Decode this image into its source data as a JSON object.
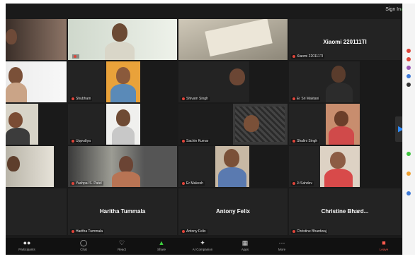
{
  "topbar": {
    "sign_in": "Sign In"
  },
  "tiles": [
    {
      "id": "t1",
      "name": ""
    },
    {
      "id": "t2",
      "name": ""
    },
    {
      "id": "t3",
      "name": ""
    },
    {
      "id": "t4",
      "big_name": "Xiaomi 220111TI",
      "name": "Xiaomi 220111TI"
    },
    {
      "id": "t5",
      "name": ""
    },
    {
      "id": "t6",
      "name": "Shubham"
    },
    {
      "id": "t7",
      "name": "Shivam Singh"
    },
    {
      "id": "t8",
      "name": "Er Sri Maktani"
    },
    {
      "id": "t9",
      "name": ""
    },
    {
      "id": "t10",
      "name": "Uppvdiya"
    },
    {
      "id": "t11",
      "name": "Sachin Kumar"
    },
    {
      "id": "t12",
      "name": "Shalini Singh"
    },
    {
      "id": "t13",
      "name": ""
    },
    {
      "id": "t14",
      "name": "Yashpal S. Patel"
    },
    {
      "id": "t15",
      "name": "Ritesh Kumar"
    },
    {
      "id": "t16",
      "name": "Er Makesh"
    },
    {
      "id": "t17",
      "name": "Ji Sahdev"
    },
    {
      "id": "t18",
      "big_name": "Haritha Tummala",
      "name": "Haritha Tummala"
    },
    {
      "id": "t19",
      "big_name": "Antony Felix",
      "name": "Antony Felix"
    },
    {
      "id": "t20",
      "big_name": "Christine Bhard...",
      "name": "Christine Bhardwaj"
    }
  ],
  "toolbar": {
    "participants": "Participants",
    "chat": "Chat",
    "react": "React",
    "share": "Share",
    "ai_companion": "AI Companion",
    "apps": "Apps",
    "more": "More",
    "leave": "Leave"
  },
  "colors": {
    "accent": "#2f8cff",
    "active_speaker": "#6ee06e",
    "leave": "#ff5a4e"
  }
}
